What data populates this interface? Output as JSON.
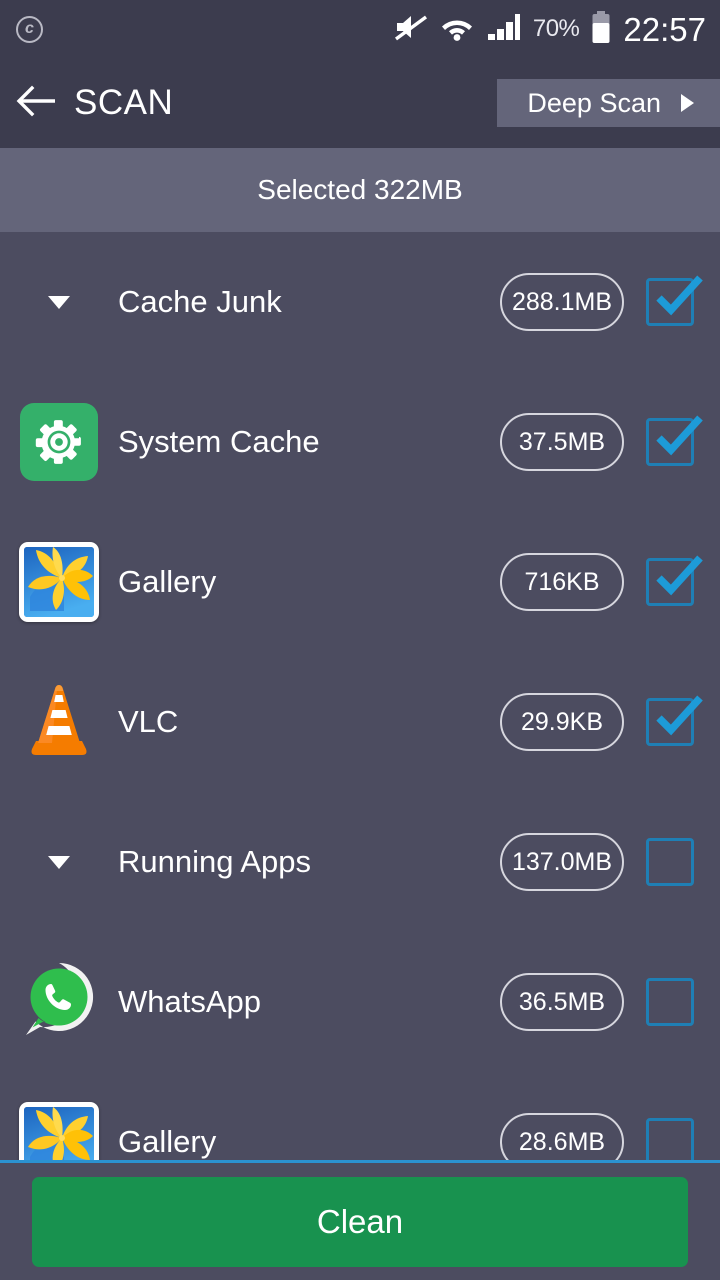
{
  "status_bar": {
    "left_icon": "circled-c-icon",
    "left_icon_glyph": "c",
    "mute_icon": "mute-icon",
    "wifi_icon": "wifi-icon",
    "signal_icon": "cellular-signal-icon",
    "battery_percent": "70%",
    "battery_icon": "battery-icon",
    "clock": "22:57"
  },
  "app_bar": {
    "back_icon": "back-arrow-icon",
    "title": "SCAN",
    "deep_scan_label": "Deep Scan",
    "deep_scan_arrow_icon": "chevron-right-icon"
  },
  "selected_bar": {
    "text": "Selected 322MB"
  },
  "groups": [
    {
      "name": "Cache Junk",
      "size": "288.1MB",
      "checked": true,
      "caret": "caret-down-icon",
      "items": [
        {
          "name": "System Cache",
          "size": "37.5MB",
          "checked": true,
          "icon": "gear-icon"
        },
        {
          "name": "Gallery",
          "size": "716KB",
          "checked": true,
          "icon": "gallery-icon"
        },
        {
          "name": "VLC",
          "size": "29.9KB",
          "checked": true,
          "icon": "vlc-cone-icon"
        }
      ]
    },
    {
      "name": "Running Apps",
      "size": "137.0MB",
      "checked": false,
      "caret": "caret-down-icon",
      "items": [
        {
          "name": "WhatsApp",
          "size": "36.5MB",
          "checked": false,
          "icon": "whatsapp-icon"
        },
        {
          "name": "Gallery",
          "size": "28.6MB",
          "checked": false,
          "icon": "gallery-icon"
        }
      ]
    }
  ],
  "bottom": {
    "clean_label": "Clean"
  },
  "colors": {
    "header_bg": "#3c3c4e",
    "body_bg": "#4c4c60",
    "band_bg": "#64657a",
    "accent_blue": "#1f7fb5",
    "check_blue": "#1d9bd8",
    "clean_green": "#18924f",
    "gear_green": "#34b06a",
    "divider_blue": "#2b92d0"
  }
}
